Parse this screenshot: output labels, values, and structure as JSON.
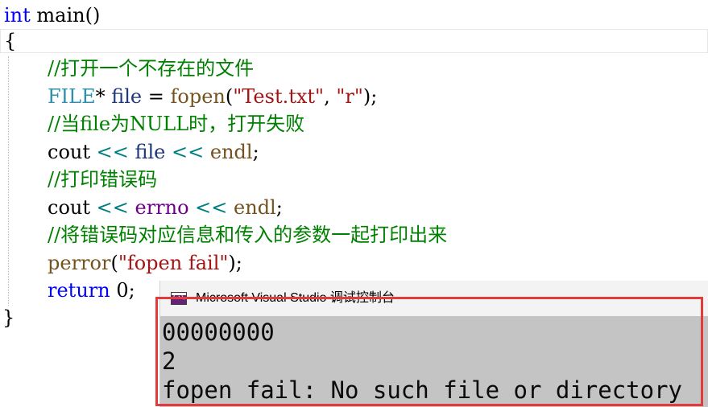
{
  "editor": {
    "lines": [
      {
        "tokens": [
          {
            "t": "int",
            "c": "kw"
          },
          {
            "t": " main()",
            "c": ""
          }
        ]
      },
      {
        "tokens": [
          {
            "t": "{",
            "c": ""
          }
        ]
      },
      {
        "tokens": [
          {
            "t": "//打开一个不存在的文件",
            "c": "cm"
          }
        ]
      },
      {
        "tokens": [
          {
            "t": "FILE",
            "c": "ty"
          },
          {
            "t": "* ",
            "c": ""
          },
          {
            "t": "file",
            "c": "var"
          },
          {
            "t": " = ",
            "c": ""
          },
          {
            "t": "fopen",
            "c": "fn"
          },
          {
            "t": "(",
            "c": ""
          },
          {
            "t": "\"Test.txt\"",
            "c": "st"
          },
          {
            "t": ", ",
            "c": ""
          },
          {
            "t": "\"r\"",
            "c": "st"
          },
          {
            "t": ");",
            "c": ""
          }
        ]
      },
      {
        "tokens": [
          {
            "t": "//当file为NULL时，打开失败",
            "c": "cm"
          }
        ]
      },
      {
        "tokens": [
          {
            "t": "cout",
            "c": ""
          },
          {
            "t": " << ",
            "c": "op"
          },
          {
            "t": "file",
            "c": "var"
          },
          {
            "t": " << ",
            "c": "op"
          },
          {
            "t": "endl",
            "c": "fn"
          },
          {
            "t": ";",
            "c": ""
          }
        ]
      },
      {
        "tokens": [
          {
            "t": "//打印错误码",
            "c": "cm"
          }
        ]
      },
      {
        "tokens": [
          {
            "t": "cout",
            "c": ""
          },
          {
            "t": " << ",
            "c": "op"
          },
          {
            "t": "errno",
            "c": "mac"
          },
          {
            "t": " << ",
            "c": "op"
          },
          {
            "t": "endl",
            "c": "fn"
          },
          {
            "t": ";",
            "c": ""
          }
        ]
      },
      {
        "tokens": [
          {
            "t": "//将错误码对应信息和传入的参数一起打印出来",
            "c": "cm"
          }
        ]
      },
      {
        "tokens": [
          {
            "t": "perror",
            "c": "fn"
          },
          {
            "t": "(",
            "c": ""
          },
          {
            "t": "\"fopen fail\"",
            "c": "st"
          },
          {
            "t": ");",
            "c": ""
          }
        ]
      },
      {
        "tokens": [
          {
            "t": "return",
            "c": "kw"
          },
          {
            "t": " 0;",
            "c": ""
          }
        ]
      },
      {
        "tokens": [
          {
            "t": "}",
            "c": ""
          }
        ]
      }
    ]
  },
  "console": {
    "title": "Microsoft Visual Studio 调试控制台",
    "output": [
      "00000000",
      "2",
      "fopen fail: No such file or directory"
    ]
  },
  "colors": {
    "highlight_border": "#e03c3c",
    "console_background": "#c4c4c4",
    "console_icon": "#68217a"
  }
}
